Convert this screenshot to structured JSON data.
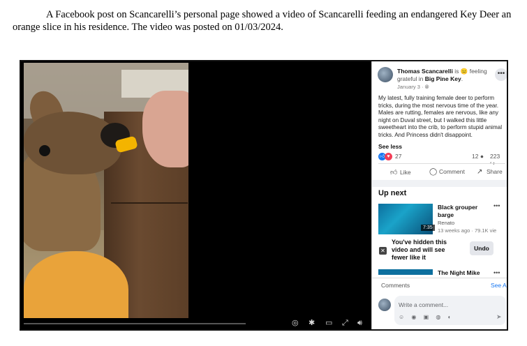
{
  "document": {
    "paragraph": "A Facebook post on Scancarelli’s personal page showed a video of Scancarelli feeding an endangered Key Deer an orange slice in his residence.  The video was posted on 01/03/2024."
  },
  "video_controls": {
    "icons": [
      "screenshot-icon",
      "settings-icon",
      "miniplayer-icon",
      "fullscreen-icon",
      "volume-icon"
    ]
  },
  "post": {
    "author": "Thomas Scancarelli",
    "is_text": "is",
    "feeling_emoji": "😐",
    "feeling_text": "feeling grateful in",
    "location": "Big Pine Key",
    "date": "January 3 ·",
    "body": "My latest, fully training female deer to perform tricks, during the most nervous time of the year. Males are rutting, females are nervous, like any night on Duval street, but I walked this little sweetheart into the crib, to perform stupid animal tricks. And Princess didn't disappoint.",
    "see_less": "See less",
    "reactions_count": "27",
    "comments_count": "12",
    "shares_count": "223",
    "actions": {
      "like": "Like",
      "comment": "Comment",
      "share": "Share"
    }
  },
  "up_next": {
    "title": "Up next",
    "videos": [
      {
        "title": "Black grouper barge",
        "author": "Renato",
        "meta": "13 weeks ago · 79.1K vie",
        "duration": "7:35"
      },
      {
        "title": "The Night Mike"
      }
    ],
    "hidden_notice": "You've hidden this video and will see fewer like it",
    "undo_label": "Undo"
  },
  "comments": {
    "label": "Comments",
    "see_all": "See Al",
    "placeholder": "Write a comment..."
  },
  "colors": {
    "facebook_blue": "#1877f2",
    "love_red": "#f33e58"
  }
}
